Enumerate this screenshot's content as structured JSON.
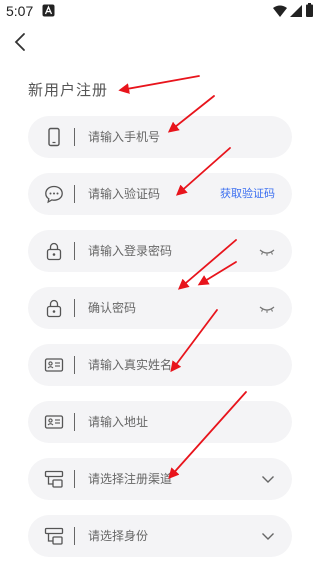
{
  "status": {
    "time": "5:07",
    "app_icon": "a-notification-icon",
    "wifi_icon": "wifi-icon",
    "signal_icon": "signal-icon",
    "battery_icon": "battery-icon"
  },
  "nav": {
    "back_icon": "back-chevron-icon"
  },
  "page_title": "新用户注册",
  "fields": [
    {
      "icon": "phone-icon",
      "label": "请输入手机号",
      "trail": ""
    },
    {
      "icon": "message-icon",
      "label": "请输入验证码",
      "trail": "获取验证码"
    },
    {
      "icon": "lock-icon",
      "label": "请输入登录密码",
      "trail": "eye-closed-icon"
    },
    {
      "icon": "lock-icon",
      "label": "确认密码",
      "trail": "eye-closed-icon"
    },
    {
      "icon": "id-card-icon",
      "label": "请输入真实姓名",
      "trail": ""
    },
    {
      "icon": "id-card-icon",
      "label": "请输入地址",
      "trail": ""
    },
    {
      "icon": "channel-icon",
      "label": "请选择注册渠道",
      "trail": "chevron-down-icon"
    },
    {
      "icon": "channel-icon",
      "label": "请选择身份",
      "trail": "chevron-down-icon"
    }
  ],
  "colors": {
    "accent": "#3c6ff0",
    "field_bg": "#f4f4f6",
    "annotation": "#e8141c"
  }
}
